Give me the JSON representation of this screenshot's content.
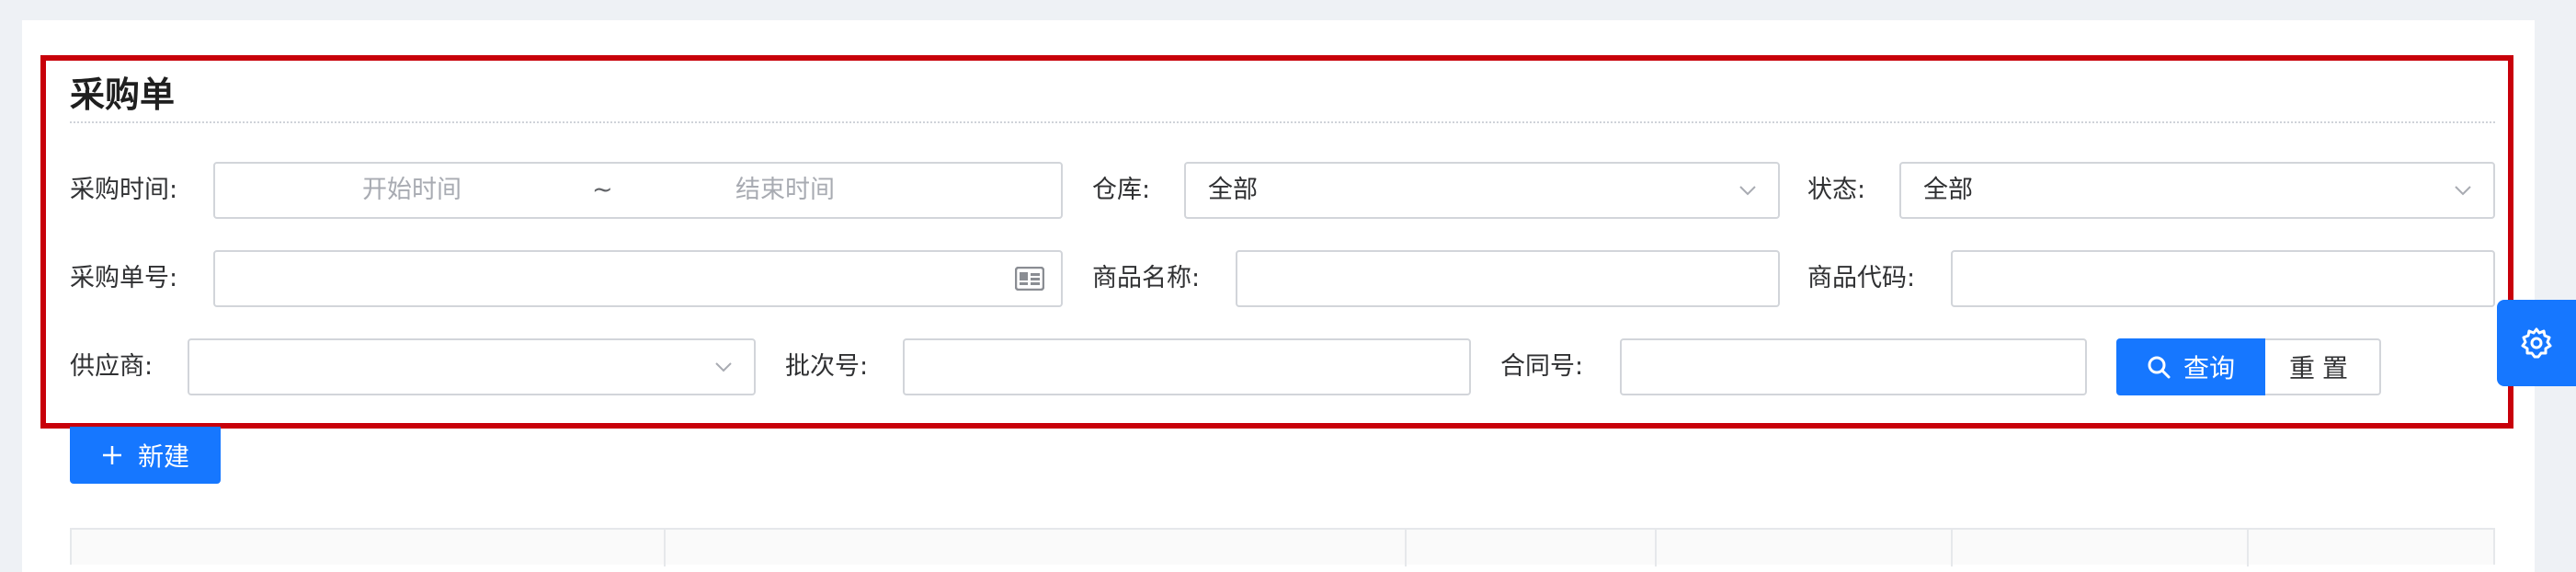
{
  "page": {
    "title": "采购单"
  },
  "filters": {
    "purchase_time": {
      "label": "采购时间:",
      "start_placeholder": "开始时间",
      "separator": "~",
      "end_placeholder": "结束时间"
    },
    "warehouse": {
      "label": "仓库:",
      "value": "全部"
    },
    "status": {
      "label": "状态:",
      "value": "全部"
    },
    "order_no": {
      "label": "采购单号:",
      "value": ""
    },
    "product_name": {
      "label": "商品名称:",
      "value": ""
    },
    "product_code": {
      "label": "商品代码:",
      "value": ""
    },
    "supplier": {
      "label": "供应商:",
      "value": ""
    },
    "batch_no": {
      "label": "批次号:",
      "value": ""
    },
    "contract_no": {
      "label": "合同号:",
      "value": ""
    }
  },
  "actions": {
    "query_label": "查询",
    "reset_label": "重置",
    "new_label": "新建"
  },
  "icons": {
    "search": "search-icon",
    "chevron": "chevron-down-icon",
    "id_card": "id-card-icon",
    "plus": "plus-icon",
    "gear": "gear-icon"
  },
  "colors": {
    "primary": "#1677ff",
    "highlight_border": "#c8000a",
    "border": "#d2d5da"
  }
}
